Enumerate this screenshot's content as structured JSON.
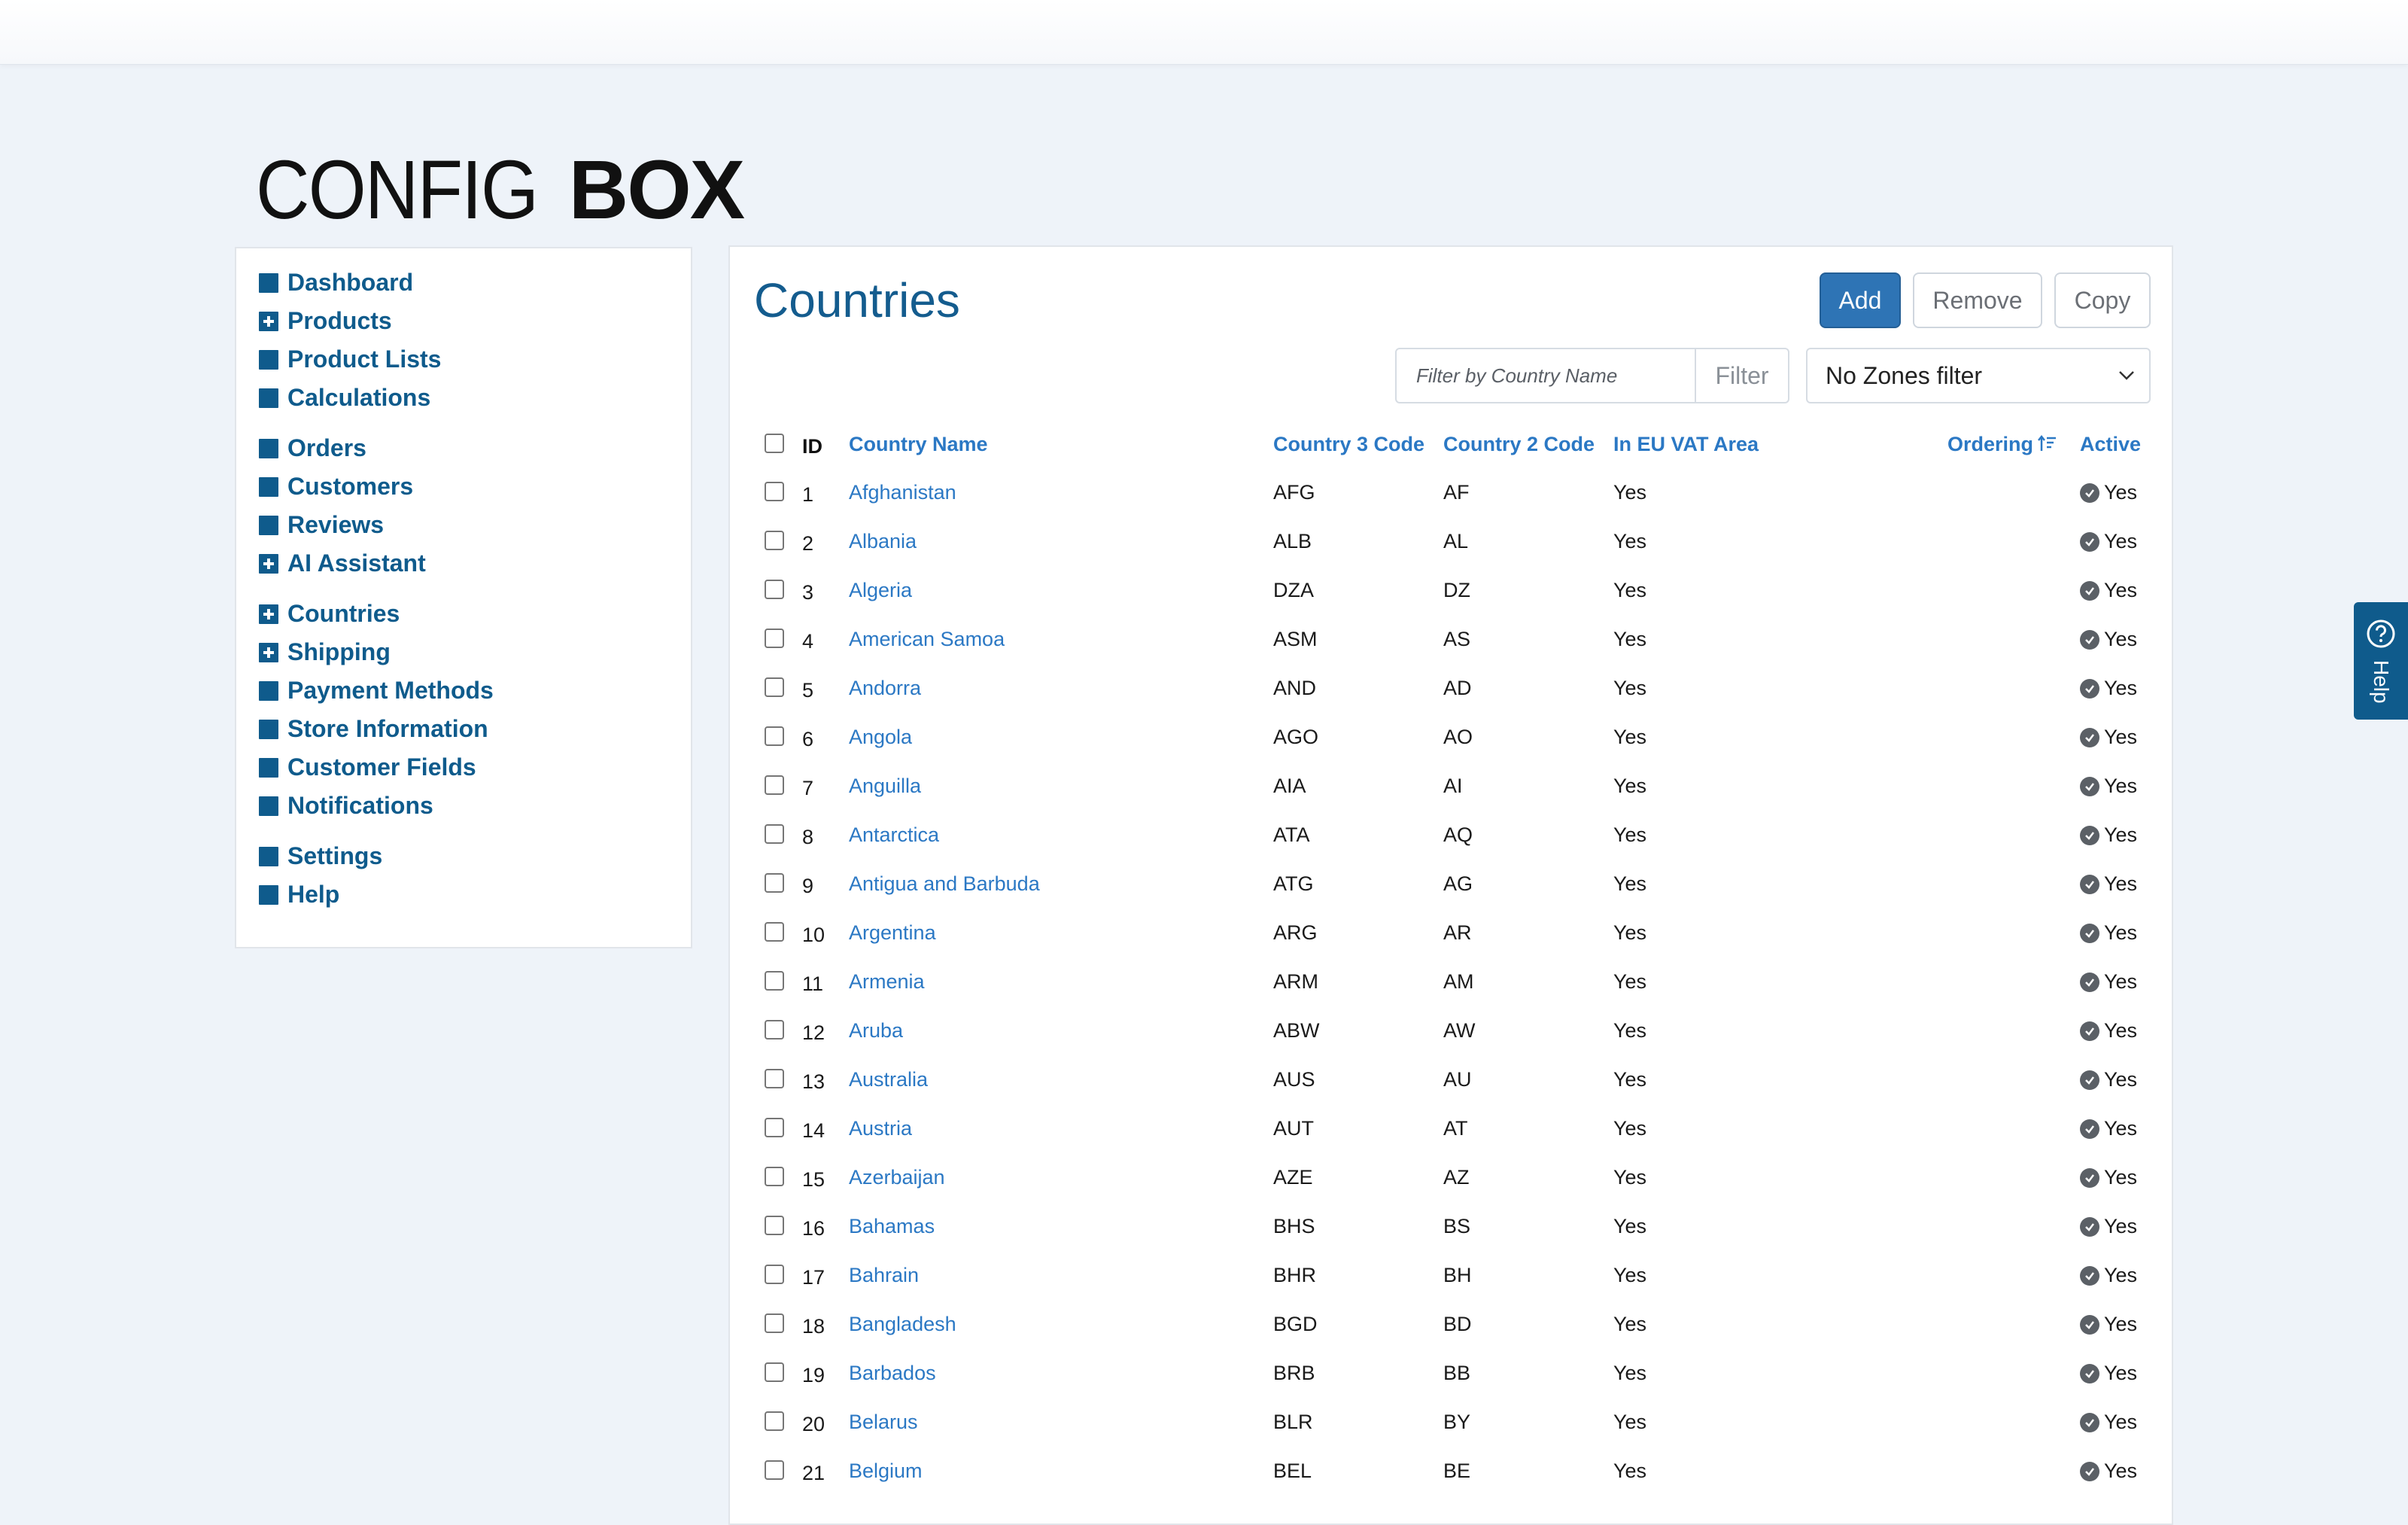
{
  "app": {
    "logo_thin": "CONFIG",
    "logo_bold": "BOX"
  },
  "sidebar": {
    "groups": [
      [
        {
          "label": "Dashboard",
          "icon": "square-icon"
        },
        {
          "label": "Products",
          "icon": "plus-square-icon"
        },
        {
          "label": "Product Lists",
          "icon": "square-icon"
        },
        {
          "label": "Calculations",
          "icon": "square-icon"
        }
      ],
      [
        {
          "label": "Orders",
          "icon": "square-icon"
        },
        {
          "label": "Customers",
          "icon": "square-icon"
        },
        {
          "label": "Reviews",
          "icon": "square-icon"
        },
        {
          "label": "AI Assistant",
          "icon": "plus-square-icon"
        }
      ],
      [
        {
          "label": "Countries",
          "icon": "plus-square-icon"
        },
        {
          "label": "Shipping",
          "icon": "plus-square-icon"
        },
        {
          "label": "Payment Methods",
          "icon": "square-icon"
        },
        {
          "label": "Store Information",
          "icon": "square-icon"
        },
        {
          "label": "Customer Fields",
          "icon": "square-icon"
        },
        {
          "label": "Notifications",
          "icon": "square-icon"
        }
      ],
      [
        {
          "label": "Settings",
          "icon": "square-icon"
        },
        {
          "label": "Help",
          "icon": "square-icon"
        }
      ]
    ]
  },
  "main": {
    "title": "Countries",
    "buttons": {
      "add": "Add",
      "remove": "Remove",
      "copy": "Copy"
    },
    "filter": {
      "placeholder": "Filter by Country Name",
      "button": "Filter"
    },
    "zones_select": "No Zones filter",
    "table": {
      "headers": {
        "id": "ID",
        "name": "Country Name",
        "code3": "Country 3 Code",
        "code2": "Country 2 Code",
        "eu": "In EU VAT Area",
        "ordering": "Ordering",
        "active": "Active"
      },
      "rows": [
        {
          "id": "1",
          "name": "Afghanistan",
          "code3": "AFG",
          "code2": "AF",
          "eu": "Yes",
          "active": "Yes"
        },
        {
          "id": "2",
          "name": "Albania",
          "code3": "ALB",
          "code2": "AL",
          "eu": "Yes",
          "active": "Yes"
        },
        {
          "id": "3",
          "name": "Algeria",
          "code3": "DZA",
          "code2": "DZ",
          "eu": "Yes",
          "active": "Yes"
        },
        {
          "id": "4",
          "name": "American Samoa",
          "code3": "ASM",
          "code2": "AS",
          "eu": "Yes",
          "active": "Yes"
        },
        {
          "id": "5",
          "name": "Andorra",
          "code3": "AND",
          "code2": "AD",
          "eu": "Yes",
          "active": "Yes"
        },
        {
          "id": "6",
          "name": "Angola",
          "code3": "AGO",
          "code2": "AO",
          "eu": "Yes",
          "active": "Yes"
        },
        {
          "id": "7",
          "name": "Anguilla",
          "code3": "AIA",
          "code2": "AI",
          "eu": "Yes",
          "active": "Yes"
        },
        {
          "id": "8",
          "name": "Antarctica",
          "code3": "ATA",
          "code2": "AQ",
          "eu": "Yes",
          "active": "Yes"
        },
        {
          "id": "9",
          "name": "Antigua and Barbuda",
          "code3": "ATG",
          "code2": "AG",
          "eu": "Yes",
          "active": "Yes"
        },
        {
          "id": "10",
          "name": "Argentina",
          "code3": "ARG",
          "code2": "AR",
          "eu": "Yes",
          "active": "Yes"
        },
        {
          "id": "11",
          "name": "Armenia",
          "code3": "ARM",
          "code2": "AM",
          "eu": "Yes",
          "active": "Yes"
        },
        {
          "id": "12",
          "name": "Aruba",
          "code3": "ABW",
          "code2": "AW",
          "eu": "Yes",
          "active": "Yes"
        },
        {
          "id": "13",
          "name": "Australia",
          "code3": "AUS",
          "code2": "AU",
          "eu": "Yes",
          "active": "Yes"
        },
        {
          "id": "14",
          "name": "Austria",
          "code3": "AUT",
          "code2": "AT",
          "eu": "Yes",
          "active": "Yes"
        },
        {
          "id": "15",
          "name": "Azerbaijan",
          "code3": "AZE",
          "code2": "AZ",
          "eu": "Yes",
          "active": "Yes"
        },
        {
          "id": "16",
          "name": "Bahamas",
          "code3": "BHS",
          "code2": "BS",
          "eu": "Yes",
          "active": "Yes"
        },
        {
          "id": "17",
          "name": "Bahrain",
          "code3": "BHR",
          "code2": "BH",
          "eu": "Yes",
          "active": "Yes"
        },
        {
          "id": "18",
          "name": "Bangladesh",
          "code3": "BGD",
          "code2": "BD",
          "eu": "Yes",
          "active": "Yes"
        },
        {
          "id": "19",
          "name": "Barbados",
          "code3": "BRB",
          "code2": "BB",
          "eu": "Yes",
          "active": "Yes"
        },
        {
          "id": "20",
          "name": "Belarus",
          "code3": "BLR",
          "code2": "BY",
          "eu": "Yes",
          "active": "Yes"
        },
        {
          "id": "21",
          "name": "Belgium",
          "code3": "BEL",
          "code2": "BE",
          "eu": "Yes",
          "active": "Yes"
        }
      ]
    }
  },
  "help_tab": {
    "label": "Help"
  },
  "colors": {
    "brand": "#0f5b8c",
    "link": "#2b78c4",
    "primary_button": "#2e74b5",
    "background": "#eef3f9"
  }
}
